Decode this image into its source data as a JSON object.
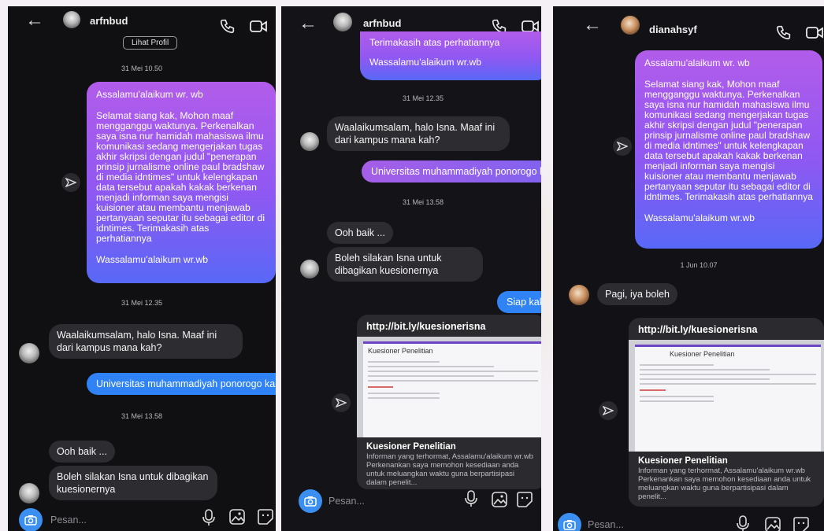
{
  "panels": [
    {
      "header": {
        "name": "arfnbud",
        "view_profile": "Lihat Profil"
      },
      "dates": [
        "31 Mei 10.50",
        "31 Mei 12.35",
        "31 Mei 13.58"
      ],
      "long_message": {
        "greeting": "Assalamu'alaikum wr. wb",
        "body": "Selamat siang kak, Mohon maaf mengganggu waktunya. Perkenalkan saya isna nur hamidah mahasiswa ilmu komunikasi sedang mengerjakan tugas akhir skripsi dengan judul \"penerapan prinsip jurnalisme online paul bradshaw di media idntimes\" untuk kelengkapan data tersebut apakah kakak berkenan menjadi informan saya mengisi kuisioner atau membantu menjawab pertanyaan seputar itu sebagai editor di idntimes. Terimakasih atas perhatiannya",
        "closing": "Wassalamu'alaikum wr.wb"
      },
      "reply1": "Waalaikumsalam, halo Isna. Maaf ini dari kampus mana kah?",
      "sent_campus": "Universitas muhammadiyah ponorogo kak",
      "reply2": "Ooh baik ...",
      "reply3": "Boleh silakan Isna untuk dibagikan kuesionernya",
      "composer_placeholder": "Pesan..."
    },
    {
      "header": {
        "name": "arfnbud"
      },
      "top_lines": [
        "Terimakasih atas perhatiannya",
        "Wassalamu'alaikum wr.wb"
      ],
      "dates": [
        "31 Mei 12.35",
        "31 Mei 13.58"
      ],
      "reply1": "Waalaikumsalam, halo Isna. Maaf ini dari kampus mana kah?",
      "sent_campus": "Universitas muhammadiyah ponorogo kak",
      "reply2": "Ooh baik ...",
      "reply3": "Boleh silakan Isna untuk dibagikan kuesionernya",
      "sent_ok": "Siap kak",
      "link": {
        "url": "http://bit.ly/kuesionerisna",
        "preview_title": "Kuesioner Penelitian",
        "title": "Kuesioner Penelitian",
        "desc": "Informan yang terhormat, Assalamu'alaikum wr.wb Perkenankan saya memohon kesediaan anda untuk meluangkan waktu guna berpartisipasi dalam penelit..."
      },
      "composer_placeholder": "Pesan..."
    },
    {
      "header": {
        "name": "dianahsyf"
      },
      "long_message": {
        "greeting": "Assalamu'alaikum wr. wb",
        "body": "Selamat siang kak, Mohon maaf mengganggu waktunya. Perkenalkan saya isna nur hamidah mahasiswa ilmu komunikasi sedang mengerjakan tugas akhir skripsi dengan judul \"penerapan prinsip jurnalisme online paul bradshaw di media idntimes\" untuk kelengkapan data tersebut apakah kakak berkenan menjadi informan saya mengisi kuisioner atau membantu menjawab pertanyaan seputar itu sebagai editor di idntimes. Terimakasih atas perhatiannya",
        "closing": "Wassalamu'alaikum wr.wb"
      },
      "date": "1 Jun 10.07",
      "reply1": "Pagi, iya boleh",
      "link": {
        "url": "http://bit.ly/kuesionerisna",
        "preview_title": "Kuesioner Penelitian",
        "title": "Kuesioner Penelitian",
        "desc": "Informan yang terhormat, Assalamu'alaikum wr.wb Perkenankan saya memohon kesediaan anda untuk meluangkan waktu guna berpartisipasi dalam penelit..."
      },
      "composer_placeholder": "Pesan..."
    }
  ],
  "icons": {
    "back": "back-arrow-icon",
    "call": "phone-icon",
    "video": "video-icon",
    "share": "share-icon",
    "camera": "camera-icon",
    "mic": "microphone-icon",
    "gallery": "gallery-icon",
    "sticker": "sticker-icon"
  },
  "colors": {
    "sent_blue": "#2f83f4",
    "gradient_top": "#b25cea",
    "gradient_bottom": "#5868f6",
    "incoming": "#2d2d31"
  }
}
